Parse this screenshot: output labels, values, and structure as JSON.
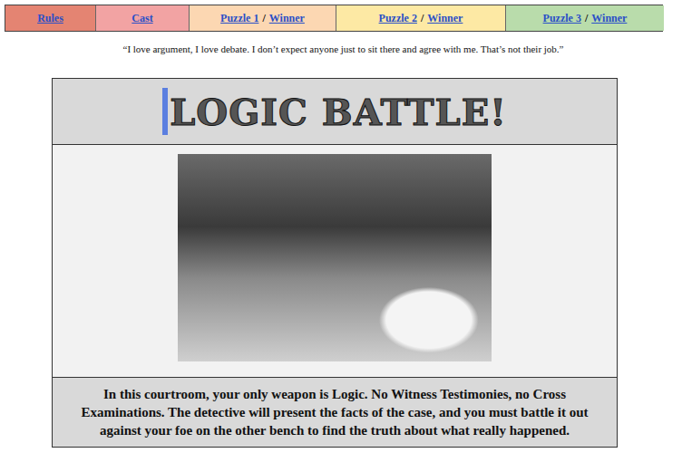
{
  "nav": [
    {
      "links": [
        "Rules"
      ],
      "color": "#e48472"
    },
    {
      "links": [
        "Cast"
      ],
      "color": "#f2a3a3"
    },
    {
      "links": [
        "Puzzle 1",
        "Winner"
      ],
      "color": "#fcd7b2"
    },
    {
      "links": [
        "Puzzle 2",
        "Winner"
      ],
      "color": "#fde9a4"
    },
    {
      "links": [
        "Puzzle 3",
        "Winner"
      ],
      "color": "#b9dcab"
    }
  ],
  "separator": "/",
  "quote": "“I love argument, I love debate. I don’t expect anyone just to sit there and agree with me. That’s not their job.”",
  "title": "LOGIC BATTLE!",
  "description": "In this courtroom, your only weapon is Logic. No Witness Testimonies, no Cross Examinations. The detective will present the facts of the case, and you must battle it out against your foe on the other bench to find the truth about what really happened."
}
